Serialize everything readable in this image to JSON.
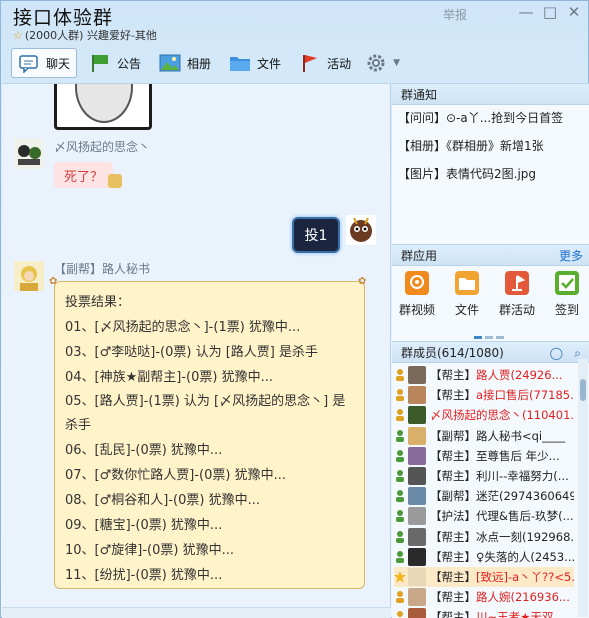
{
  "header": {
    "title": "接口体验群",
    "subtitle": "(2000人群) 兴趣爱好-其他",
    "report": "举报",
    "min_glyph": "—",
    "max_glyph": "□",
    "close_glyph": "✕"
  },
  "toolbar": {
    "items": [
      {
        "label": "聊天"
      },
      {
        "label": "公告"
      },
      {
        "label": "相册"
      },
      {
        "label": "文件"
      },
      {
        "label": "活动"
      }
    ]
  },
  "chat": {
    "msg1": {
      "sender": "〆风扬起的思念丶",
      "text": "死了？"
    },
    "vote_tag": "投1",
    "msg2": {
      "sender": "【副帮】路人秘书",
      "lines": [
        "投票结果：",
        "01、[〆风扬起的思念丶]-(1票) 犹豫中...",
        "03、[♂李哒哒]-(0票) 认为 [路人贾] 是杀手",
        "04、[神族★副帮主]-(0票) 犹豫中...",
        "05、[路人贾]-(1票) 认为 [〆风扬起的思念丶] 是杀手",
        "06、[乱民]-(0票) 犹豫中...",
        "07、[♂数你忙路人贾]-(0票) 犹豫中...",
        "08、[♂桐谷和人]-(0票) 犹豫中...",
        "09、[糖宝]-(0票) 犹豫中...",
        "10、[♂旋律]-(0票) 犹豫中...",
        "11、[纷扰]-(0票) 犹豫中..."
      ]
    }
  },
  "notice": {
    "heading": "群通知",
    "rows": [
      "【问问】⊙-a丫...抢到今日首签",
      "【相册】《群相册》新增1张",
      "【图片】表情代码2图.jpg"
    ]
  },
  "apps": {
    "heading": "群应用",
    "more": "更多",
    "items": [
      {
        "label": "群视频",
        "color": "#f08a1c"
      },
      {
        "label": "文件",
        "color": "#f2a433"
      },
      {
        "label": "群活动",
        "color": "#e25a3a"
      },
      {
        "label": "签到",
        "color": "#5aae2e"
      }
    ]
  },
  "members": {
    "heading": "群成员(614/1080)",
    "rows": [
      {
        "role": "【帮主】",
        "name": "路人贾(24926...",
        "owner": true
      },
      {
        "role": "【帮主】",
        "name": "a接口售后(77185...",
        "owner": true
      },
      {
        "role": "",
        "name": "〆风扬起的思念丶(110401...",
        "owner": true
      },
      {
        "role": "【副帮】",
        "name": "路人秘书<qi____",
        "owner": false
      },
      {
        "role": "【帮主】",
        "name": "至尊售后  年少...",
        "owner": false
      },
      {
        "role": "【帮主】",
        "name": "利川--幸福努力(...",
        "owner": false
      },
      {
        "role": "【副帮】",
        "name": "迷茫(2974360649)",
        "owner": false
      },
      {
        "role": "【护法】",
        "name": "代理&售后-玖梦(...",
        "owner": false
      },
      {
        "role": "【帮主】",
        "name": "冰点一刻(192968...",
        "owner": false
      },
      {
        "role": "【帮主】",
        "name": "♀失落的人(2453...",
        "owner": false
      },
      {
        "role": "【帮主】",
        "name": "[致远]-a丶丫??<5...",
        "owner": true,
        "highlight": true
      },
      {
        "role": "【帮主】",
        "name": "路人婉(216936...",
        "owner": true
      },
      {
        "role": "【帮主】",
        "name": "川~王者★无双...",
        "owner": true
      }
    ]
  }
}
